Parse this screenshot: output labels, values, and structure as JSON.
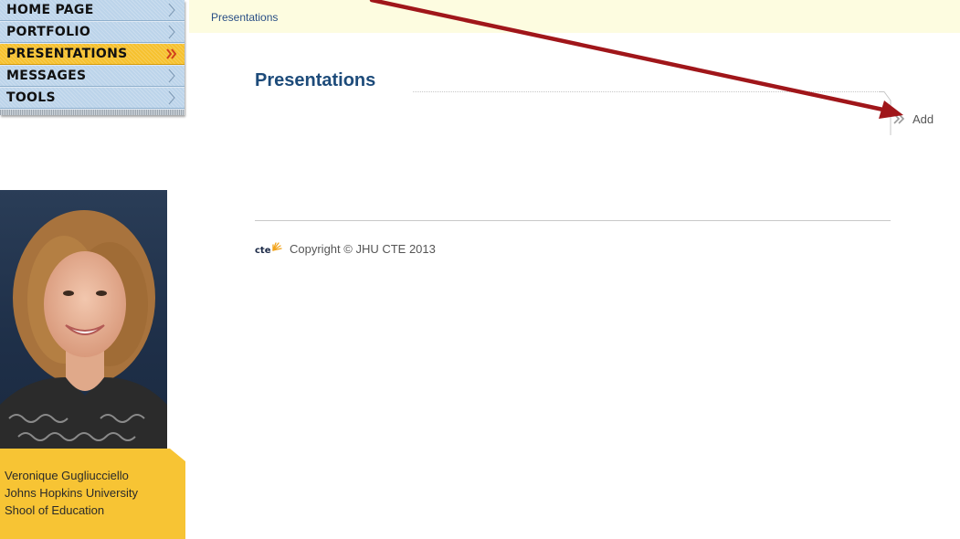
{
  "nav": {
    "items": [
      {
        "label": "HOME PAGE",
        "active": false
      },
      {
        "label": "PORTFOLIO",
        "active": false
      },
      {
        "label": "PRESENTATIONS",
        "active": true
      },
      {
        "label": "MESSAGES",
        "active": false
      },
      {
        "label": "TOOLS",
        "active": false
      }
    ]
  },
  "breadcrumb": {
    "current": "Presentations"
  },
  "main": {
    "title": "Presentations",
    "add_label": "Add"
  },
  "profile": {
    "name": "Veronique Gugliucciello",
    "institution": "Johns Hopkins University",
    "school": "Shool of Education"
  },
  "footer": {
    "logo_text": "cte",
    "copyright": "Copyright © JHU CTE 2013"
  },
  "colors": {
    "nav_bg": "#bcd4ea",
    "nav_active": "#f6c12e",
    "title_blue": "#1d4b7a",
    "crumb_bar": "#fdfce0",
    "profile_card": "#f7c434",
    "arrow_red": "#a0161a"
  },
  "icons": {
    "nav_chevron": "chevron-right-icon",
    "nav_active_chevron": "double-chevron-right-icon",
    "add": "double-chevron-right-icon",
    "logo_burst": "sunburst-icon"
  }
}
